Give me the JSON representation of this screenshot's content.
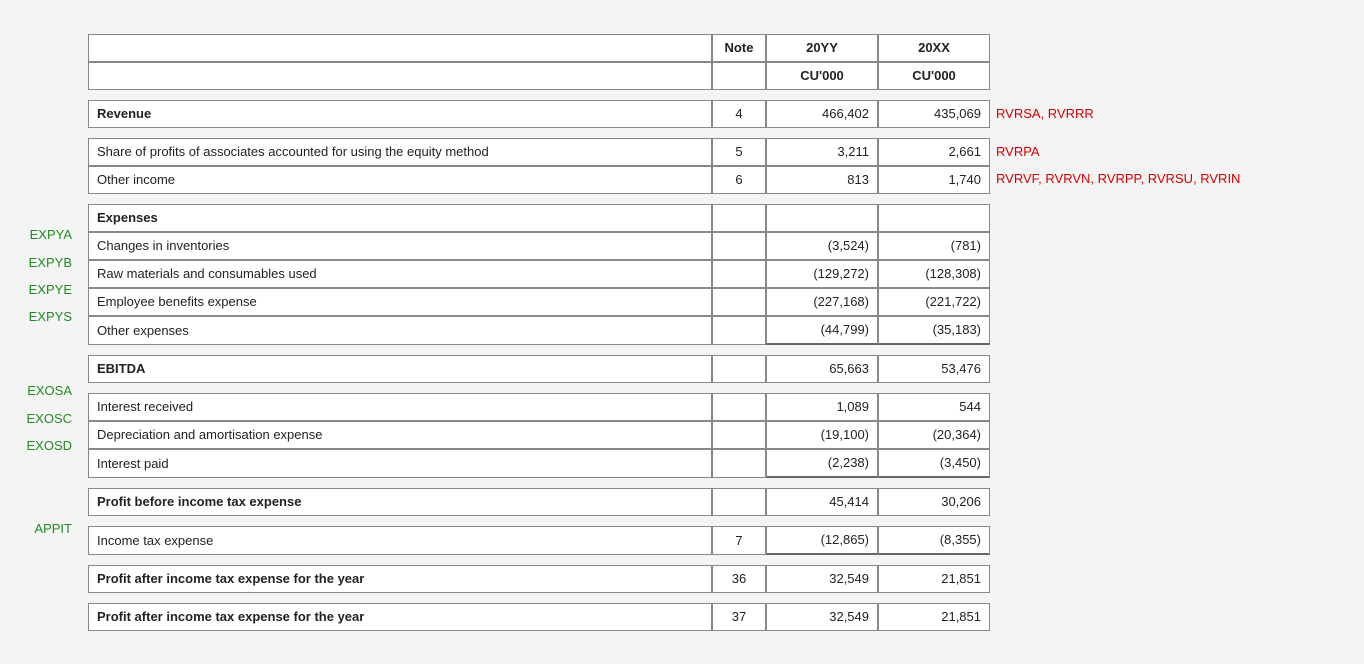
{
  "headers": {
    "note": "Note",
    "colY": "20YY",
    "colX": "20XX",
    "unitY": "CU'000",
    "unitX": "CU'000"
  },
  "rows": {
    "revenue": {
      "label": "Revenue",
      "note": "4",
      "y": "466,402",
      "x": "435,069"
    },
    "share_profits": {
      "label": "Share of profits of associates accounted for using the equity method",
      "note": "5",
      "y": "3,211",
      "x": "2,661"
    },
    "other_income": {
      "label": "Other income",
      "note": "6",
      "y": "813",
      "x": "1,740"
    },
    "expenses_hdr": {
      "label": "Expenses"
    },
    "chg_inv": {
      "label": "Changes in inventories",
      "note": "",
      "y": "(3,524)",
      "x": "(781)"
    },
    "raw_mat": {
      "label": "Raw materials and consumables used",
      "note": "",
      "y": "(129,272)",
      "x": "(128,308)"
    },
    "emp_ben": {
      "label": "Employee benefits expense",
      "note": "",
      "y": "(227,168)",
      "x": "(221,722)"
    },
    "other_exp": {
      "label": "Other expenses",
      "note": "",
      "y": "(44,799)",
      "x": "(35,183)"
    },
    "ebitda": {
      "label": "EBITDA",
      "note": "",
      "y": "65,663",
      "x": "53,476"
    },
    "int_recv": {
      "label": "Interest received",
      "note": "",
      "y": "1,089",
      "x": "544"
    },
    "dep_amort": {
      "label": "Depreciation and amortisation expense",
      "note": "",
      "y": "(19,100)",
      "x": "(20,364)"
    },
    "int_paid": {
      "label": "Interest paid",
      "note": "",
      "y": "(2,238)",
      "x": "(3,450)"
    },
    "pbt": {
      "label": "Profit before income tax expense",
      "note": "",
      "y": "45,414",
      "x": "30,206"
    },
    "tax": {
      "label": "Income tax expense",
      "note": "7",
      "y": "(12,865)",
      "x": "(8,355)"
    },
    "pat1": {
      "label": "Profit after income tax expense for the year",
      "note": "36",
      "y": "32,549",
      "x": "21,851"
    },
    "pat2": {
      "label": "Profit after income tax expense for the year",
      "note": "37",
      "y": "32,549",
      "x": "21,851"
    }
  },
  "left_annos": {
    "expya": "EXPYA",
    "expyb": "EXPYB",
    "expye": "EXPYE",
    "expys": "EXPYS",
    "exosa": "EXOSA",
    "exosc": "EXOSC",
    "exosd": "EXOSD",
    "appit": "APPIT"
  },
  "right_annos": {
    "revenue": "RVRSA, RVRRR",
    "share_profits": "RVRPA",
    "other_income": "RVRVF, RVRVN, RVRPP, RVRSU, RVRIN"
  }
}
